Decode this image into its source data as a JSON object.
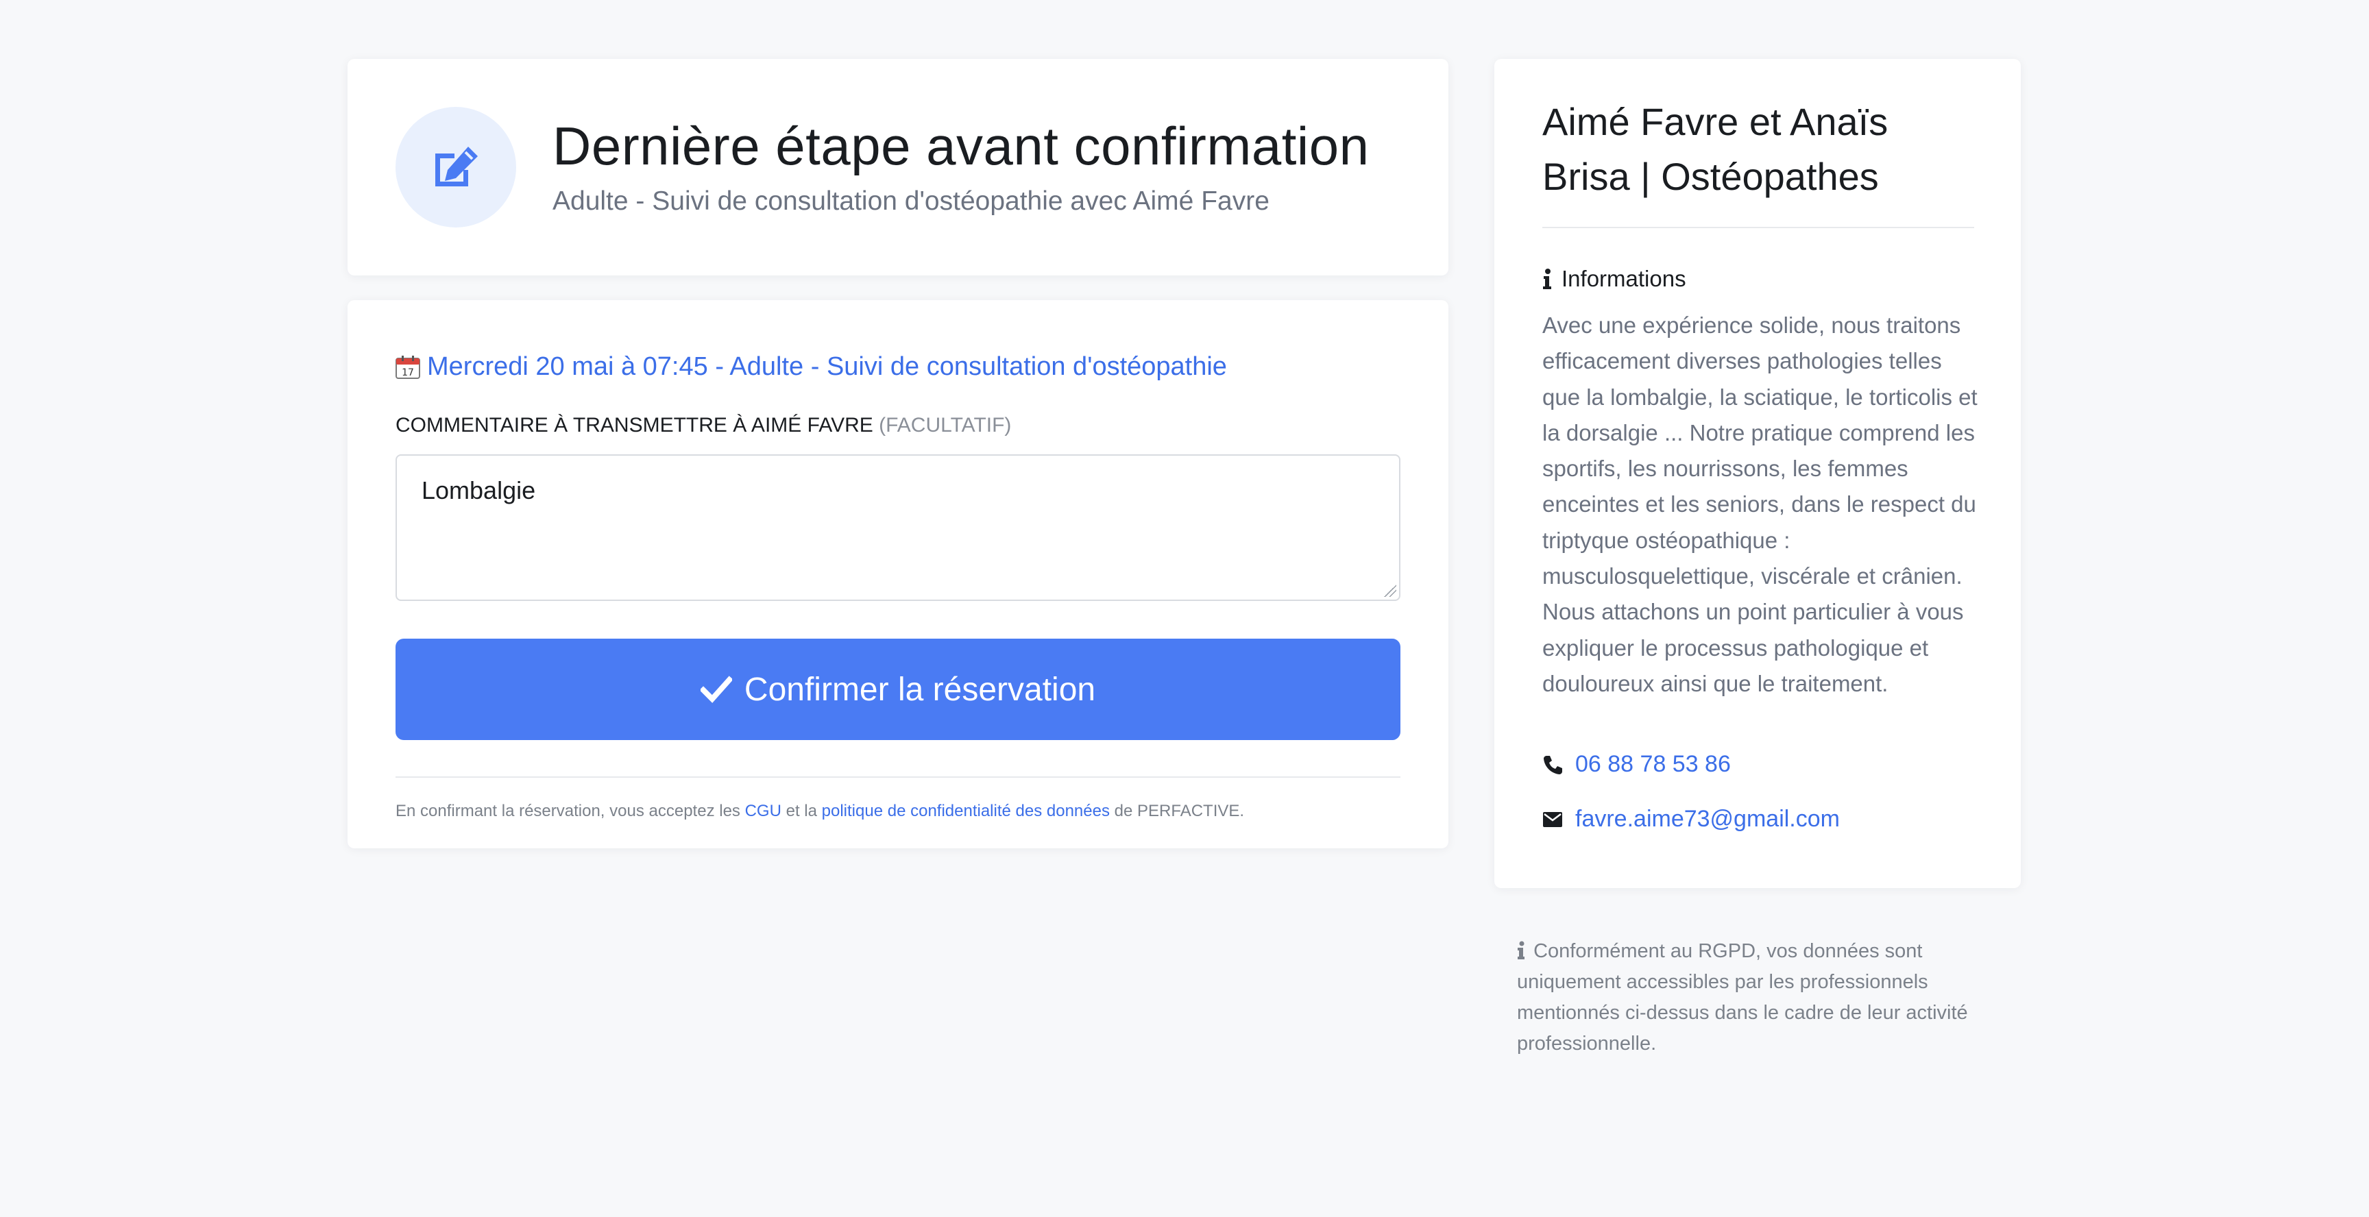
{
  "header": {
    "title": "Dernière étape avant confirmation",
    "subtitle": "Adulte - Suivi de consultation d'ostéopathie avec Aimé Favre"
  },
  "booking": {
    "slot": "Mercredi 20 mai à 07:45 - Adulte - Suivi de consultation d'ostéopathie",
    "comment_label": "COMMENTAIRE À TRANSMETTRE À AIMÉ FAVRE",
    "comment_optional": "(FACULTATIF)",
    "comment_value": "Lombalgie",
    "confirm_label": "Confirmer la réservation",
    "legal": {
      "prefix": "En confirmant la réservation, vous acceptez les",
      "cgu_link": "CGU",
      "middle": "et la",
      "privacy_link": "politique de confidentialité des données",
      "suffix": "de PERFACTIVE."
    }
  },
  "sidebar": {
    "title": "Aimé Favre et Anaïs Brisa | Ostéopathes",
    "info_heading": "Informations",
    "info_text": "Avec une expérience solide, nous traitons efficacement diverses pathologies telles que la lombalgie, la sciatique, le torticolis et la dorsalgie ... Notre pratique comprend les sportifs, les nourrissons, les femmes enceintes et les seniors, dans le respect du triptyque ostéopathique : musculosquelettique, viscérale et crânien. Nous attachons un point particulier à vous expliquer le processus pathologique et douloureux ainsi que le traitement.",
    "phone": "06 88 78 53 86",
    "email": "favre.aime73@gmail.com"
  },
  "rgpd_notice": "Conformément au RGPD, vos données sont uniquement accessibles par les professionnels mentionnés ci-dessus dans le cadre de leur activité professionnelle.",
  "colors": {
    "accent": "#4a7bf3",
    "link": "#3b6ee8",
    "background": "#f7f8fa",
    "icon_circle": "#e9f0fd"
  },
  "icons": {
    "header": "edit-icon",
    "slot": "calendar-icon",
    "confirm": "check-icon",
    "info": "info-icon",
    "phone": "phone-icon",
    "email": "envelope-icon"
  }
}
